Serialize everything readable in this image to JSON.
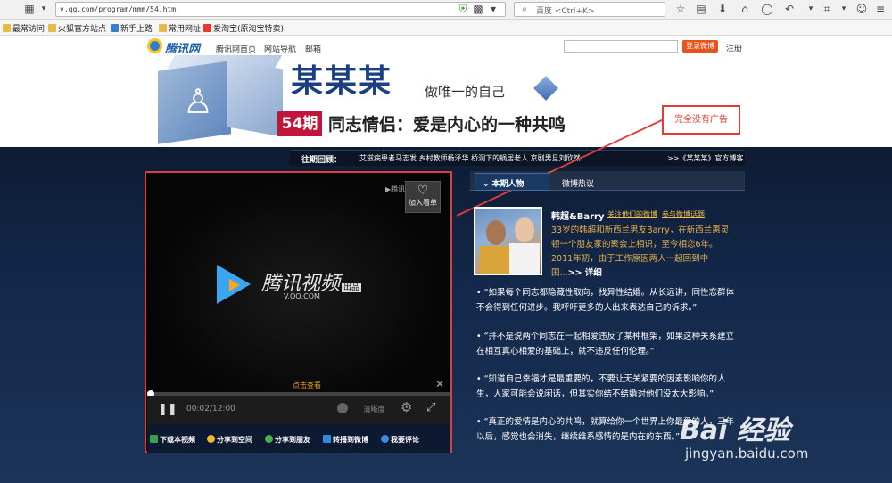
{
  "browser": {
    "url": "v.qq.com/program/mmm/54.htm",
    "search_placeholder": "百度 <Ctrl+K>",
    "bookmarks": [
      "最常访问",
      "火狐官方站点",
      "新手上路",
      "常用网址",
      "爱淘宝(原淘宝特卖)"
    ]
  },
  "site": {
    "logo": "腾讯网",
    "nav": [
      "腾讯网首页",
      "网站导航",
      "邮箱"
    ],
    "login_button": "登录微博",
    "register": "注册"
  },
  "banner": {
    "brand": "某某某",
    "slogan": "做唯一的自己",
    "issue": "54期",
    "issue_title": "同志情侣：爱是内心的一种共鸣"
  },
  "annotation": "完全没有广告",
  "past": {
    "label": "往期回顾：",
    "items": "艾滋病患者马志发  乡村教师杨泽华  桥洞下的蜗居老人  京剧男旦刘欣然",
    "right": ">>《某某某》官方博客"
  },
  "player": {
    "watermark": "▶腾讯",
    "add_button": "加入看单",
    "logo_text": "腾讯视频",
    "logo_badge": "出品",
    "logo_sub": "V.QQ.COM",
    "click_watch": "点击查看",
    "time_current": "00:02",
    "time_total": "/12:00",
    "clarity": "清晰度",
    "actions": [
      "下载本视频",
      "分享到空间",
      "分享到朋友",
      "转播到微博",
      "我要评论"
    ]
  },
  "panel": {
    "tab_active": "本期人物",
    "tab_other": "微博热议",
    "person_name": "韩超&Barry",
    "link_follow": "关注他们的微博",
    "link_topic": "参与微博话题",
    "bio": [
      "33岁的韩超和新西兰男友Barry，在新西兰惠灵",
      "顿一个朋友家的聚会上相识，至今相恋6年。",
      "2011年初，由于工作原因两人一起回到中",
      "国..."
    ],
    "detail": ">> 详细",
    "quotes": [
      "“如果每个同志都隐藏性取向，找异性结婚。从长远讲，同性恋群体不会得到任何进步。我呼吁更多的人出来表达自己的诉求。”",
      "“并不是说两个同志在一起相爱违反了某种框架，如果这种关系建立在相互真心相爱的基础上，就不违反任何伦理。”",
      "“知道自己幸福才是最重要的，不要让无关紧要的因素影响你的人生，人家可能会说闲话，但其实你结不结婚对他们没太大影响。”",
      "“真正的爱情是内心的共鸣，就算给你一个世界上你最爱的人，三年以后，感觉也会消失，继续维系感情的是内在的东西。”"
    ]
  },
  "watermark": {
    "brand": "Bai 经验",
    "url": "jingyan.baidu.com"
  },
  "colors": {
    "annotation_red": "#e23b3b",
    "issue_red": "#c0163b",
    "brand_blue": "#1b3f80",
    "bio_gold": "#e8b04c"
  }
}
